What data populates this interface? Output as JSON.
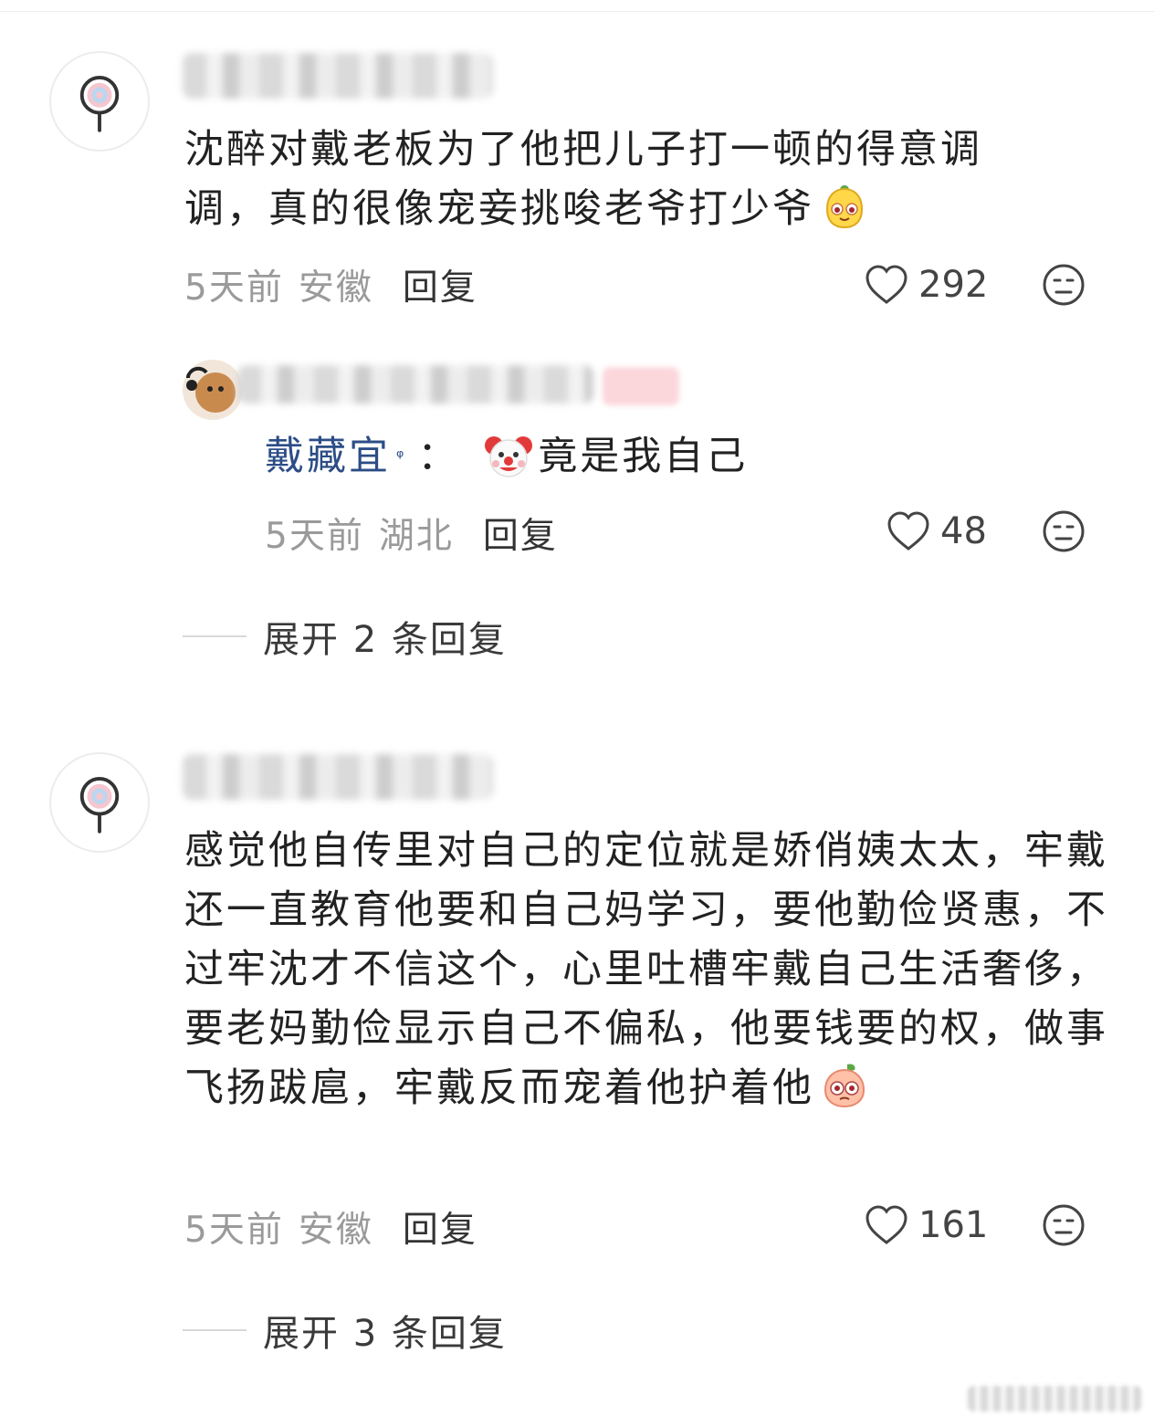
{
  "comments": [
    {
      "text": "沈醉对戴老板为了他把儿子打一顿的得意调调，真的很像宠妾挑唆老爷打少爷",
      "emoji": "mango-face-emoji",
      "time": "5天前",
      "location": "安徽",
      "reply_label": "回复",
      "likes": "292",
      "replies": [
        {
          "mention": "戴藏宜",
          "mention_badge": "ᵠ",
          "colon": "：",
          "emoji": "clown-face-emoji",
          "text": "竟是我自己",
          "time": "5天前",
          "location": "湖北",
          "reply_label": "回复",
          "likes": "48"
        }
      ],
      "expand_label": "展开 2 条回复"
    },
    {
      "text": "感觉他自传里对自己的定位就是娇俏姨太太，牢戴还一直教育他要和自己妈学习，要他勤俭贤惠，不过牢沈才不信这个，心里吐槽牢戴自己生活奢侈，要老妈勤俭显示自己不偏私，他要钱要的权，做事飞扬跋扈，牢戴反而宠着他护着他",
      "emoji": "peach-face-emoji",
      "time": "5天前",
      "location": "安徽",
      "reply_label": "回复",
      "likes": "161",
      "expand_label": "展开 3 条回复"
    }
  ],
  "colors": {
    "mention": "#2c4d86",
    "meta": "#9a9a9a",
    "text": "#222222"
  }
}
